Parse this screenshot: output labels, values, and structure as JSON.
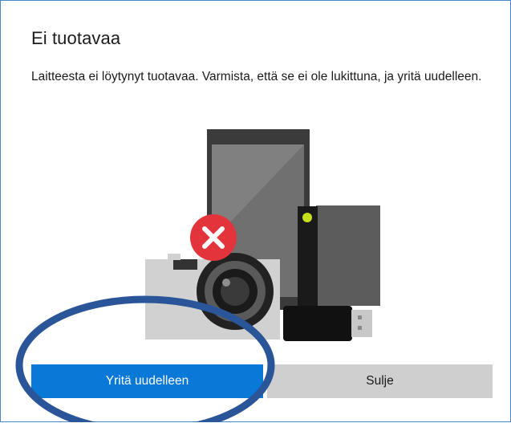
{
  "dialog": {
    "title": "Ei tuotavaa",
    "message": "Laitteesta ei löytynyt tuotavaa. Varmista, että se ei ole lukittuna, ja yritä uudelleen.",
    "retry_label": "Yritä uudelleen",
    "close_label": "Sulje"
  },
  "colors": {
    "border": "#4a86c8",
    "primary_button": "#0a78d7",
    "secondary_button": "#cfcfcf",
    "error_badge": "#e3343c",
    "annotation_ellipse": "#2a5598"
  },
  "icons": {
    "illustration": "devices-illustration",
    "badge": "error-x-icon"
  }
}
